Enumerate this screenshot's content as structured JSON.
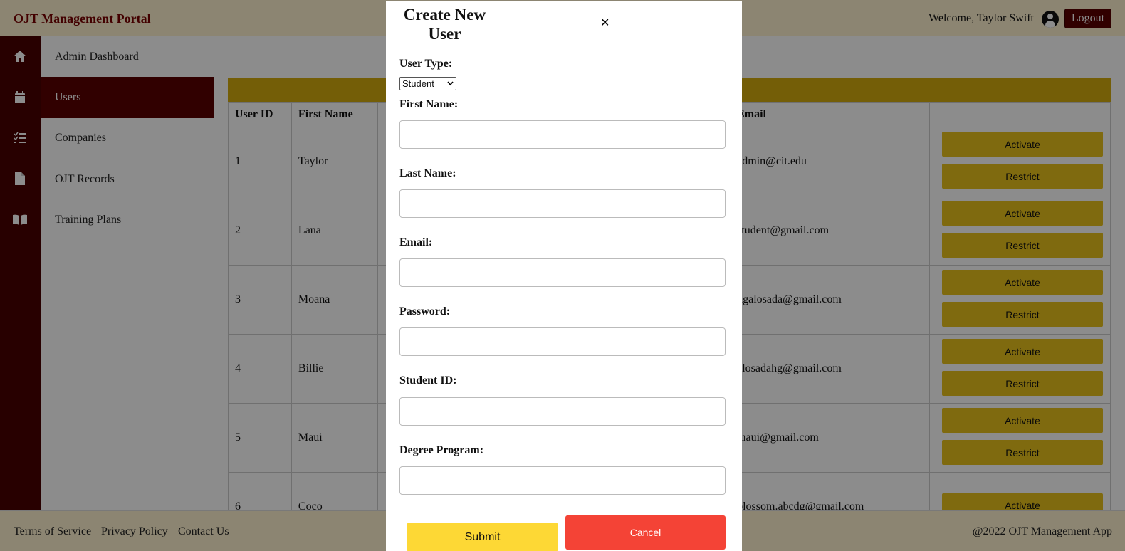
{
  "header": {
    "brand": "OJT Management Portal",
    "welcome": "Welcome, Taylor Swift",
    "logout_label": "Logout"
  },
  "sidebar": {
    "items": [
      {
        "label": "Admin Dashboard",
        "icon": "home-icon"
      },
      {
        "label": "Users",
        "icon": "calendar-icon",
        "active": true
      },
      {
        "label": "Companies",
        "icon": "list-icon"
      },
      {
        "label": "OJT Records",
        "icon": "file-icon"
      },
      {
        "label": "Training Plans",
        "icon": "book-icon"
      }
    ]
  },
  "table": {
    "headers": [
      "User ID",
      "First Name",
      "Email"
    ],
    "rows": [
      {
        "id": "1",
        "first_name": "Taylor",
        "email": "admin@cit.edu"
      },
      {
        "id": "2",
        "first_name": "Lana",
        "email": "student@gmail.com"
      },
      {
        "id": "3",
        "first_name": "Moana",
        "email": "hgalosada@gmail.com"
      },
      {
        "id": "4",
        "first_name": "Billie",
        "email": "alosadahg@gmail.com"
      },
      {
        "id": "5",
        "first_name": "Maui",
        "email": "maui@gmail.com"
      },
      {
        "id": "6",
        "first_name": "Coco",
        "email": "blossom.abcdg@gmail.com"
      }
    ],
    "activate_label": "Activate",
    "restrict_label": "Restrict"
  },
  "footer": {
    "terms": "Terms of Service",
    "privacy": "Privacy Policy",
    "contact": "Contact Us",
    "copyright": "@2022 OJT Management App"
  },
  "modal": {
    "title": "Create New User",
    "close_symbol": "✕",
    "user_type_label": "User Type:",
    "user_type_value": "Student",
    "first_name_label": "First Name:",
    "last_name_label": "Last Name:",
    "email_label": "Email:",
    "password_label": "Password:",
    "student_id_label": "Student ID:",
    "degree_program_label": "Degree Program:",
    "submit_label": "Submit",
    "cancel_label": "Cancel"
  },
  "colors": {
    "maroon": "#5a0000",
    "header_bg": "#fff3cf",
    "yellow": "#e8c21c",
    "cancel_red": "#f44336",
    "submit_yellow": "#fdd835"
  }
}
